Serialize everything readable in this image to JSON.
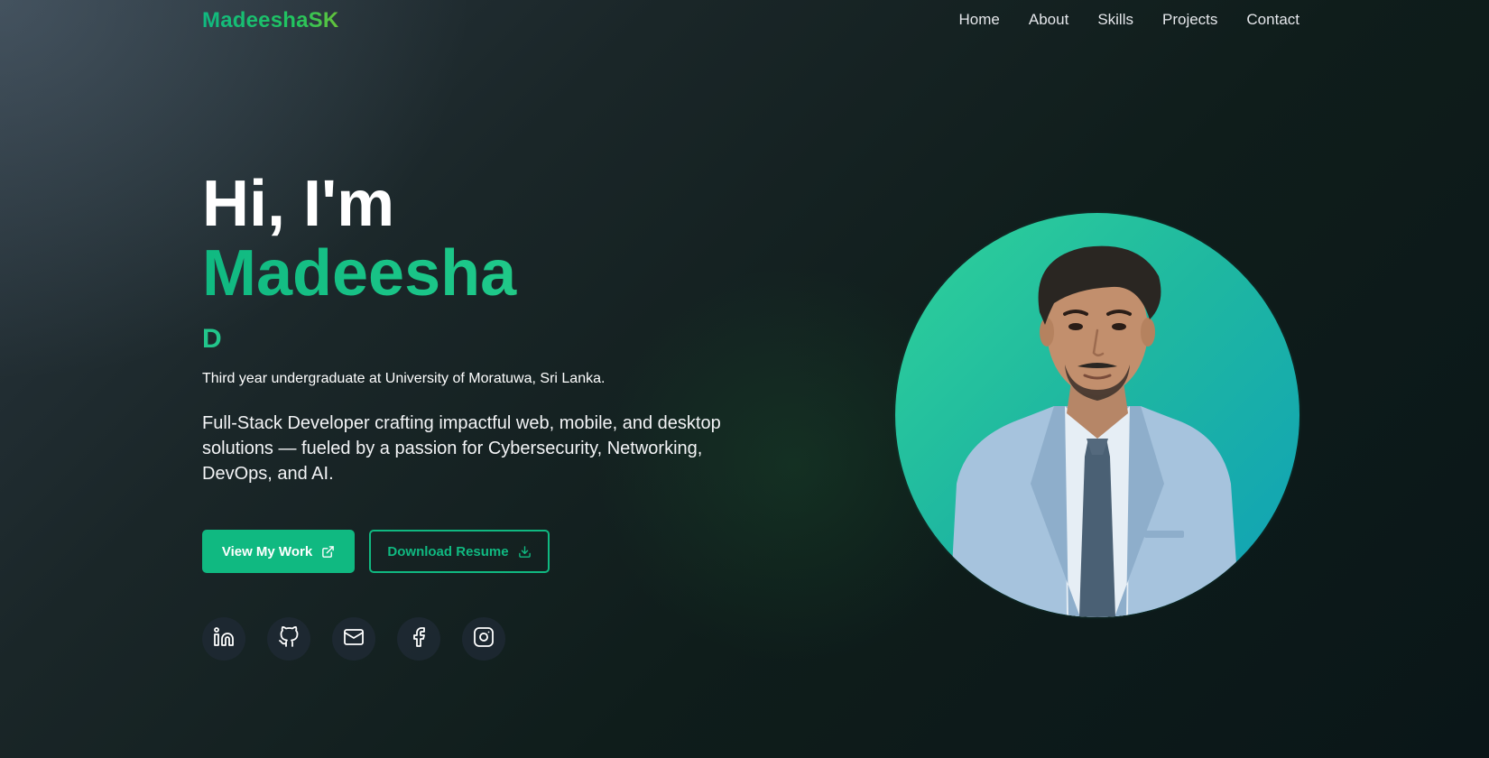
{
  "brand": {
    "logo_text": "MadeeshaSK"
  },
  "nav": {
    "items": [
      "Home",
      "About",
      "Skills",
      "Projects",
      "Contact"
    ]
  },
  "hero": {
    "greeting": "Hi, I'm",
    "name": "Madeesha",
    "typed_text": "D",
    "subtitle": "Third year undergraduate at University of Moratuwa, Sri Lanka.",
    "description": "Full-Stack Developer crafting impactful web, mobile, and desktop solutions — fueled by a passion for Cybersecurity, Networking, DevOps, and AI."
  },
  "buttons": {
    "primary_label": "View My Work",
    "primary_icon": "external-link-icon",
    "secondary_label": "Download Resume",
    "secondary_icon": "download-icon"
  },
  "social": {
    "icons": [
      "linkedin-icon",
      "github-icon",
      "mail-icon",
      "facebook-icon",
      "instagram-icon"
    ]
  },
  "colors": {
    "accent": "#10b981",
    "accent_green": "#5bc23c",
    "background_dark": "#0f1d1b",
    "text": "#e5e7eb"
  }
}
